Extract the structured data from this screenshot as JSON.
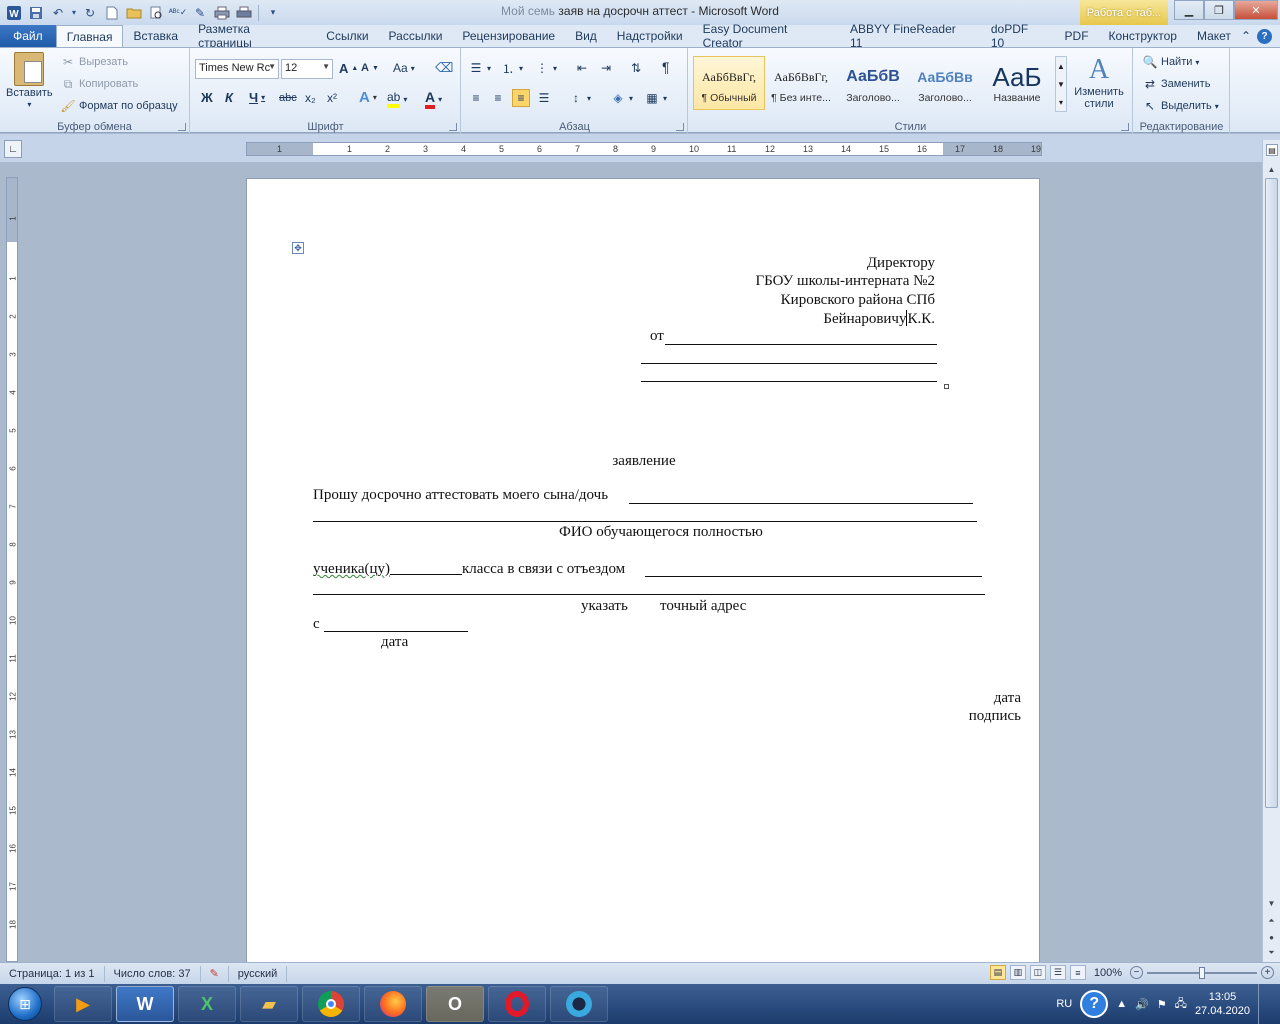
{
  "window": {
    "doc_title": "заяв на досрочн аттест",
    "faded_prefix": "Мой семь",
    "separator": " - ",
    "app_name": "Microsoft Word",
    "context_tab": "Работа с таб...",
    "min_icon": "minimize-icon",
    "restore_icon": "restore-icon",
    "close_icon": "close-icon"
  },
  "tabs": {
    "file": "Файл",
    "items": [
      "Главная",
      "Вставка",
      "Разметка страницы",
      "Ссылки",
      "Рассылки",
      "Рецензирование",
      "Вид",
      "Надстройки",
      "Easy Document Creator",
      "ABBYY FineReader 11",
      "doPDF 10",
      "PDF",
      "Конструктор",
      "Макет"
    ],
    "active_index": 0
  },
  "clipboard": {
    "paste": "Вставить",
    "cut": "Вырезать",
    "copy": "Копировать",
    "format_painter": "Формат по образцу",
    "label": "Буфер обмена"
  },
  "font": {
    "name": "Times New Rc",
    "size": "12",
    "grow": "A",
    "shrink": "A",
    "case": "Aa",
    "bold": "Ж",
    "italic": "К",
    "underline": "Ч",
    "strike": "abc",
    "sub": "x₂",
    "sup": "x²",
    "effects": "A",
    "highlight": "ab",
    "color": "A",
    "label": "Шрифт"
  },
  "paragraph": {
    "pilcrow": "¶",
    "label": "Абзац"
  },
  "styles": {
    "items": [
      {
        "sample": "АаБбВвГг,",
        "name": "¶ Обычный"
      },
      {
        "sample": "АаБбВвГг,",
        "name": "¶ Без инте..."
      },
      {
        "sample": "АаБбВ",
        "name": "Заголово..."
      },
      {
        "sample": "АаБбВв",
        "name": "Заголово..."
      },
      {
        "sample": "АаБ",
        "name": "Название"
      }
    ],
    "change": "Изменить стили",
    "label": "Стили"
  },
  "editing": {
    "find": "Найти",
    "replace": "Заменить",
    "select": "Выделить",
    "label": "Редактирование"
  },
  "ruler": {
    "h_ticks": [
      "1",
      "1",
      "2",
      "3",
      "4",
      "5",
      "6",
      "7",
      "8",
      "9",
      "10",
      "11",
      "12",
      "13",
      "14",
      "15",
      "16",
      "17",
      "18",
      "19"
    ],
    "v_ticks": [
      "1",
      "1",
      "2",
      "3",
      "4",
      "5",
      "6",
      "7",
      "8",
      "9",
      "10",
      "11",
      "12",
      "13",
      "14",
      "15",
      "16",
      "17",
      "18"
    ]
  },
  "document": {
    "addressee": [
      "Директору",
      "ГБОУ школы-интерната №2",
      "Кировского района СПб"
    ],
    "addressee_name_a": "Бейнаровичу",
    "addressee_name_b": "К.К.",
    "from_label": "от",
    "title": "заявление",
    "request_line": "Прошу досрочно аттестовать моего сына/дочь",
    "fio_caption": "ФИО обучающегося полностью",
    "pupil_a": "ученика(цу)",
    "pupil_b": "класса в связи с отъездом",
    "address_caption_a": "указать",
    "address_caption_b": "точный адрес",
    "from_date_label": "с",
    "date_caption": "дата",
    "sign_date": "дата",
    "sign": "подпись"
  },
  "status": {
    "page": "Страница: 1 из 1",
    "words": "Число слов: 37",
    "lang": "русский",
    "zoom": "100%",
    "zoom_fraction": 0.5
  },
  "taskbar": {
    "lang": "RU",
    "time": "13:05",
    "date": "27.04.2020",
    "apps": [
      "media-player-icon",
      "word-icon",
      "excel-icon",
      "explorer-icon",
      "chrome-icon",
      "firefox-icon",
      "outlook-icon",
      "opera-icon",
      "browser-icon"
    ]
  }
}
